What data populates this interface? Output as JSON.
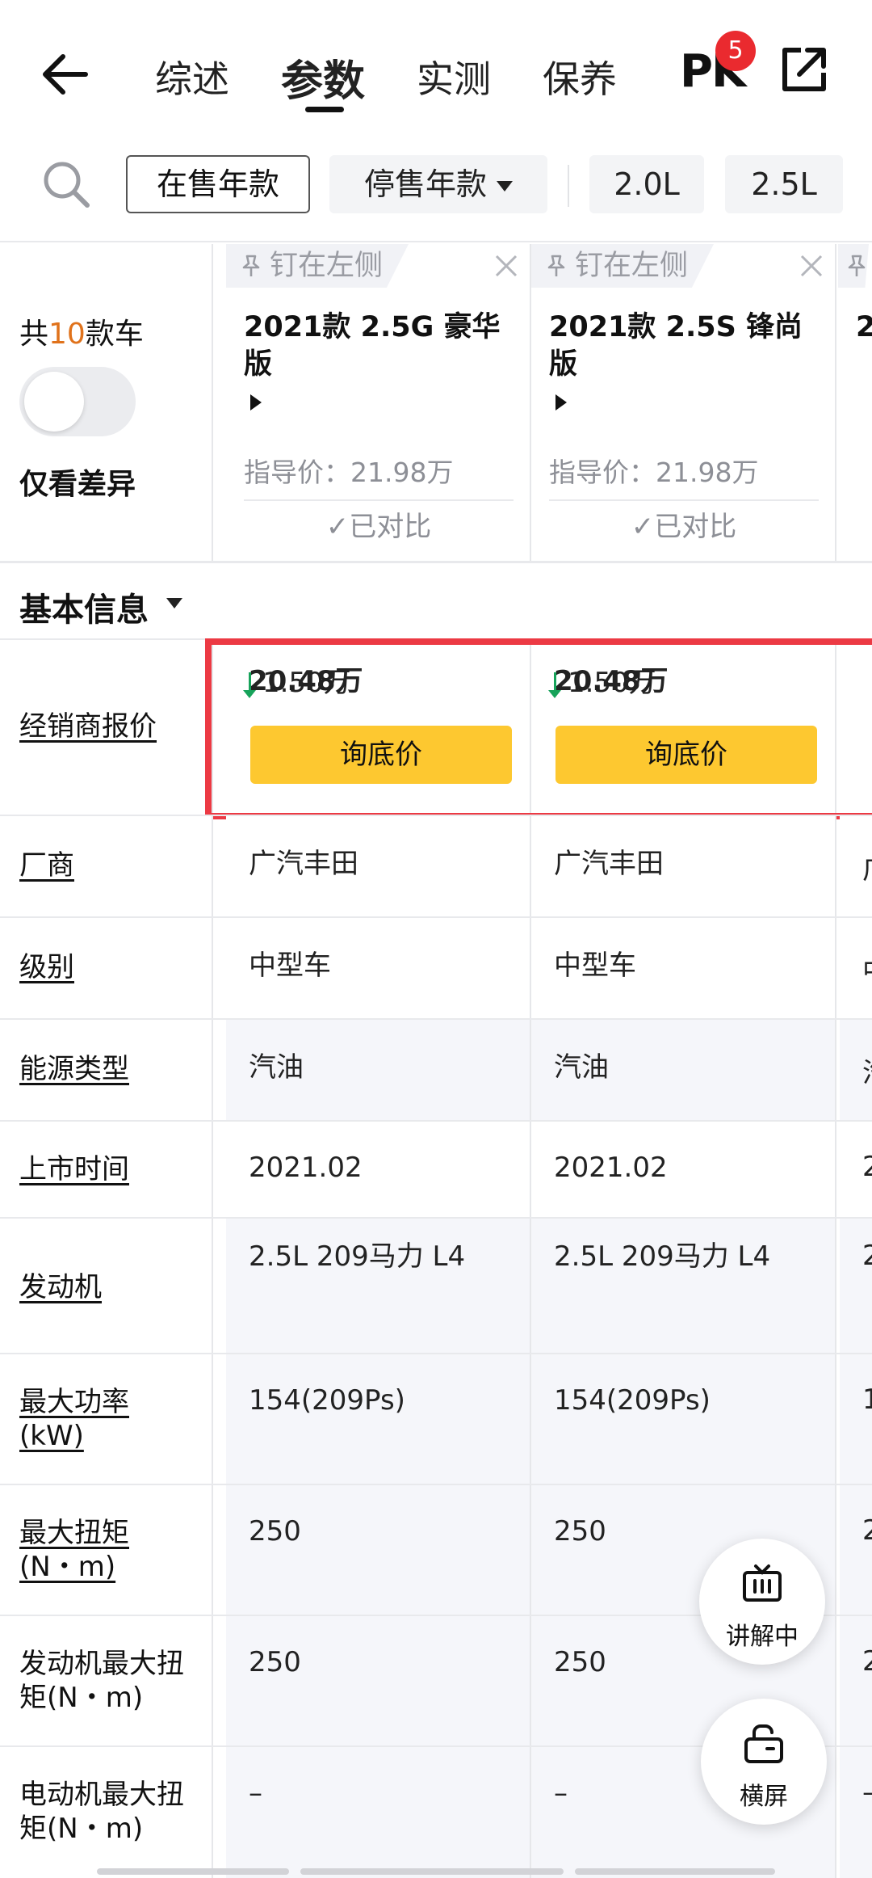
{
  "nav": {
    "tabs": [
      "综述",
      "参数",
      "实测",
      "保养"
    ],
    "pk_label": "PK",
    "pk_badge": "5"
  },
  "filters": {
    "on_sale": "在售年款",
    "discontinued": "停售年款",
    "engines": [
      "2.0L",
      "2.5L"
    ]
  },
  "header": {
    "count_prefix": "共",
    "count_num": "10",
    "count_suffix": "款车",
    "only_diff": "仅看差异",
    "cards": [
      {
        "pin": "钉在左侧",
        "name": "2021款 2.5G 豪华版",
        "guide_price": "指导价：21.98万",
        "compared": "✓已对比"
      },
      {
        "pin": "钉在左侧",
        "name": "2021款 2.5S 锋尚版",
        "guide_price": "指导价：21.98万",
        "compared": "✓已对比"
      }
    ],
    "partial_name": "2"
  },
  "section": {
    "title": "基本信息"
  },
  "dealer_row": {
    "label": "经销商报价",
    "cells": [
      {
        "price": "20.48万",
        "drop": "1.50万",
        "button": "询底价"
      },
      {
        "price": "20.48万",
        "drop": "1.50万",
        "button": "询底价"
      }
    ]
  },
  "rows": [
    {
      "label": "厂商",
      "values": [
        "广汽丰田",
        "广汽丰田"
      ],
      "peek": "广"
    },
    {
      "label": "级别",
      "values": [
        "中型车",
        "中型车"
      ],
      "peek": "中"
    },
    {
      "label": "能源类型",
      "values": [
        "汽油",
        "汽油"
      ],
      "peek": "汽"
    },
    {
      "label": "上市时间",
      "values": [
        "2021.02",
        "2021.02"
      ],
      "peek": "2"
    },
    {
      "label": "发动机",
      "values": [
        "2.5L 209马力 L4",
        "2.5L 209马力 L4"
      ],
      "peek": "2"
    },
    {
      "label_lines": [
        "最大功率",
        "(kW)"
      ],
      "values": [
        "154(209Ps)",
        "154(209Ps)"
      ],
      "peek": "1"
    },
    {
      "label_lines": [
        "最大扭矩",
        "(N・m)"
      ],
      "values": [
        "250",
        "250"
      ],
      "peek": "2"
    },
    {
      "label_lines": [
        "发动机最大扭",
        "矩(N・m)"
      ],
      "values": [
        "250",
        "250"
      ],
      "peek": "2"
    },
    {
      "label_lines": [
        "电动机最大扭",
        "矩(N・m)"
      ],
      "values": [
        "–",
        "–"
      ],
      "peek": "–"
    }
  ],
  "fabs": {
    "explain": "讲解中",
    "landscape": "横屏"
  }
}
